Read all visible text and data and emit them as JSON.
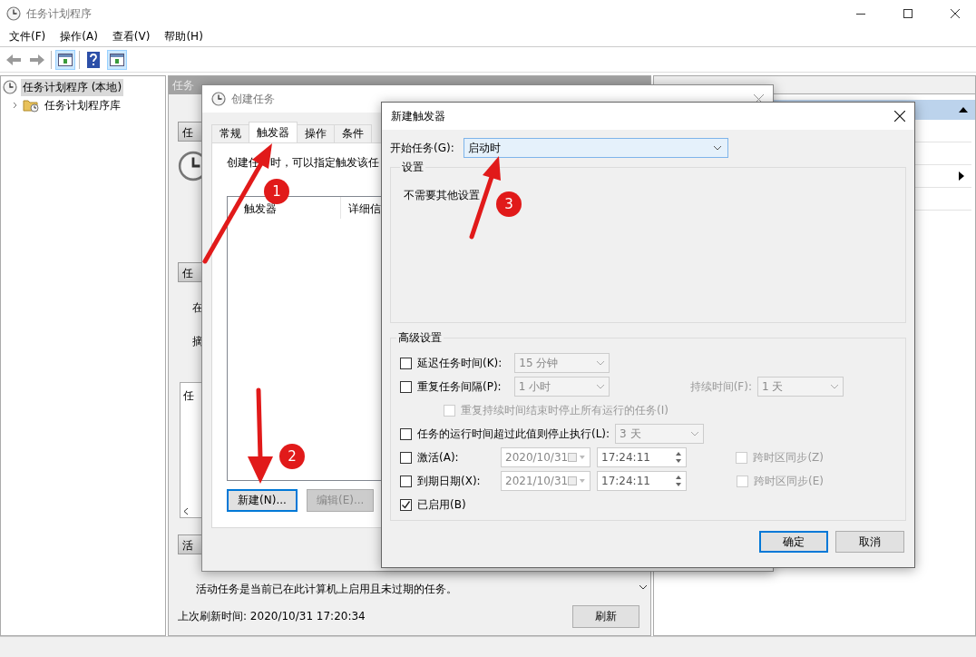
{
  "window": {
    "title": "任务计划程序"
  },
  "menu": [
    "文件(F)",
    "操作(A)",
    "查看(V)",
    "帮助(H)"
  ],
  "toolbar": [
    {
      "kind": "back",
      "pressed": false
    },
    {
      "kind": "forward",
      "pressed": false
    },
    {
      "kind": "pane",
      "pressed": true
    },
    {
      "kind": "help",
      "pressed": false
    },
    {
      "kind": "pane",
      "pressed": true
    }
  ],
  "tree": [
    {
      "label": "任务计划程序 (本地)",
      "selected": true,
      "children": [
        {
          "label": "任务计划程序库",
          "selected": false,
          "expanded": false
        }
      ]
    }
  ],
  "summary_pane": {
    "header": "任务",
    "sections": [
      {
        "kind": "header",
        "text": "任"
      },
      {
        "kind": "clock"
      },
      {
        "kind": "header",
        "text": "任"
      },
      {
        "kind": "text",
        "text": "在"
      },
      {
        "kind": "text",
        "text": "摘"
      },
      {
        "kind": "listbox",
        "text": "任"
      },
      {
        "kind": "header",
        "text": "活"
      }
    ],
    "note": "活动任务是当前已在此计算机上启用且未过期的任务。",
    "last_refresh": "上次刷新时间: 2020/10/31 17:20:34",
    "refresh_button": "刷新"
  },
  "actions_pane": {
    "items": [
      {
        "kind": "header",
        "expanded": true
      },
      {
        "kind": "row"
      },
      {
        "kind": "row"
      },
      {
        "kind": "submenu"
      },
      {
        "kind": "row"
      }
    ]
  },
  "create_task_dialog": {
    "title": "创建任务",
    "tabs": [
      {
        "label": "常规",
        "selected": false
      },
      {
        "label": "触发器",
        "selected": true
      },
      {
        "label": "操作",
        "selected": false
      },
      {
        "label": "条件",
        "selected": false
      }
    ],
    "description": [
      "创建任",
      "时，可以指定触发该任"
    ],
    "columns": [
      "触发器",
      "详细信"
    ],
    "buttons": [
      {
        "label": "新建(N)...",
        "focused": true,
        "disabled": false
      },
      {
        "label": "编辑(E)...",
        "focused": false,
        "disabled": true
      }
    ]
  },
  "new_trigger_dialog": {
    "title": "新建触发器",
    "start_label": "开始任务(G):",
    "start_value": "启动时",
    "settings": {
      "legend": "设置",
      "text": "不需要其他设置"
    },
    "advanced": {
      "legend": "高级设置",
      "rows": [
        {
          "kind": "combo",
          "label": "延迟任务时间(K):",
          "checked": false,
          "value": "15 分钟"
        },
        {
          "kind": "combo",
          "label": "重复任务间隔(P):",
          "checked": false,
          "value": "1 小时",
          "extra": {
            "label": "持续时间(F):",
            "value": "1 天"
          }
        },
        {
          "kind": "note",
          "label": "重复持续时间结束时停止所有运行的任务(I)",
          "checked": false,
          "disabled": true
        },
        {
          "kind": "combo",
          "label": "任务的运行时间超过此值则停止执行(L):",
          "checked": false,
          "value": "3 天"
        },
        {
          "kind": "datetime",
          "label": "激活(A):",
          "checked": false,
          "date": "2020/10/31",
          "time": "17:24:11",
          "sync": {
            "label": "跨时区同步(Z)",
            "checked": false
          }
        },
        {
          "kind": "datetime",
          "label": "到期日期(X):",
          "checked": false,
          "date": "2021/10/31",
          "time": "17:24:11",
          "sync": {
            "label": "跨时区同步(E)",
            "checked": false
          }
        },
        {
          "kind": "toggle",
          "label": "已启用(B)",
          "checked": true
        }
      ]
    },
    "buttons": [
      {
        "label": "确定",
        "focused": true
      },
      {
        "label": "取消",
        "focused": false
      }
    ]
  },
  "annotations": [
    {
      "label": "1"
    },
    {
      "label": "2"
    },
    {
      "label": "3"
    }
  ]
}
